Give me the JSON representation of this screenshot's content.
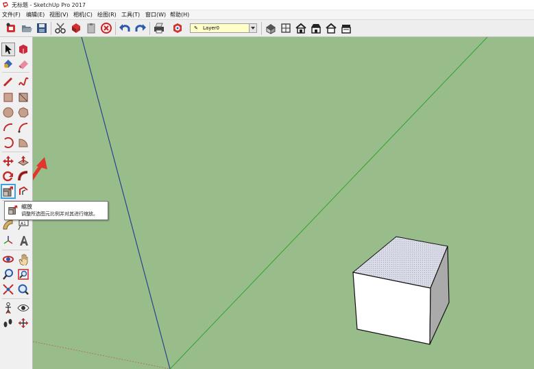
{
  "window": {
    "title": "无标题 - SketchUp Pro 2017"
  },
  "menu": [
    "文件(F)",
    "编辑(E)",
    "视图(V)",
    "相机(C)",
    "绘图(R)",
    "工具(T)",
    "窗口(W)",
    "帮助(H)"
  ],
  "toolbar": {
    "layer_name": "Layer0"
  },
  "tooltip": {
    "name": "缩放",
    "description": "调整所选图元比例并对其进行缩放。"
  },
  "colors": {
    "viewport_bg": "#98bd8b",
    "blue_axis": "#2c3f8c",
    "green_axis": "#2ba32b",
    "red_axis": "#b0735e",
    "highlight": "#3aa0e6"
  }
}
